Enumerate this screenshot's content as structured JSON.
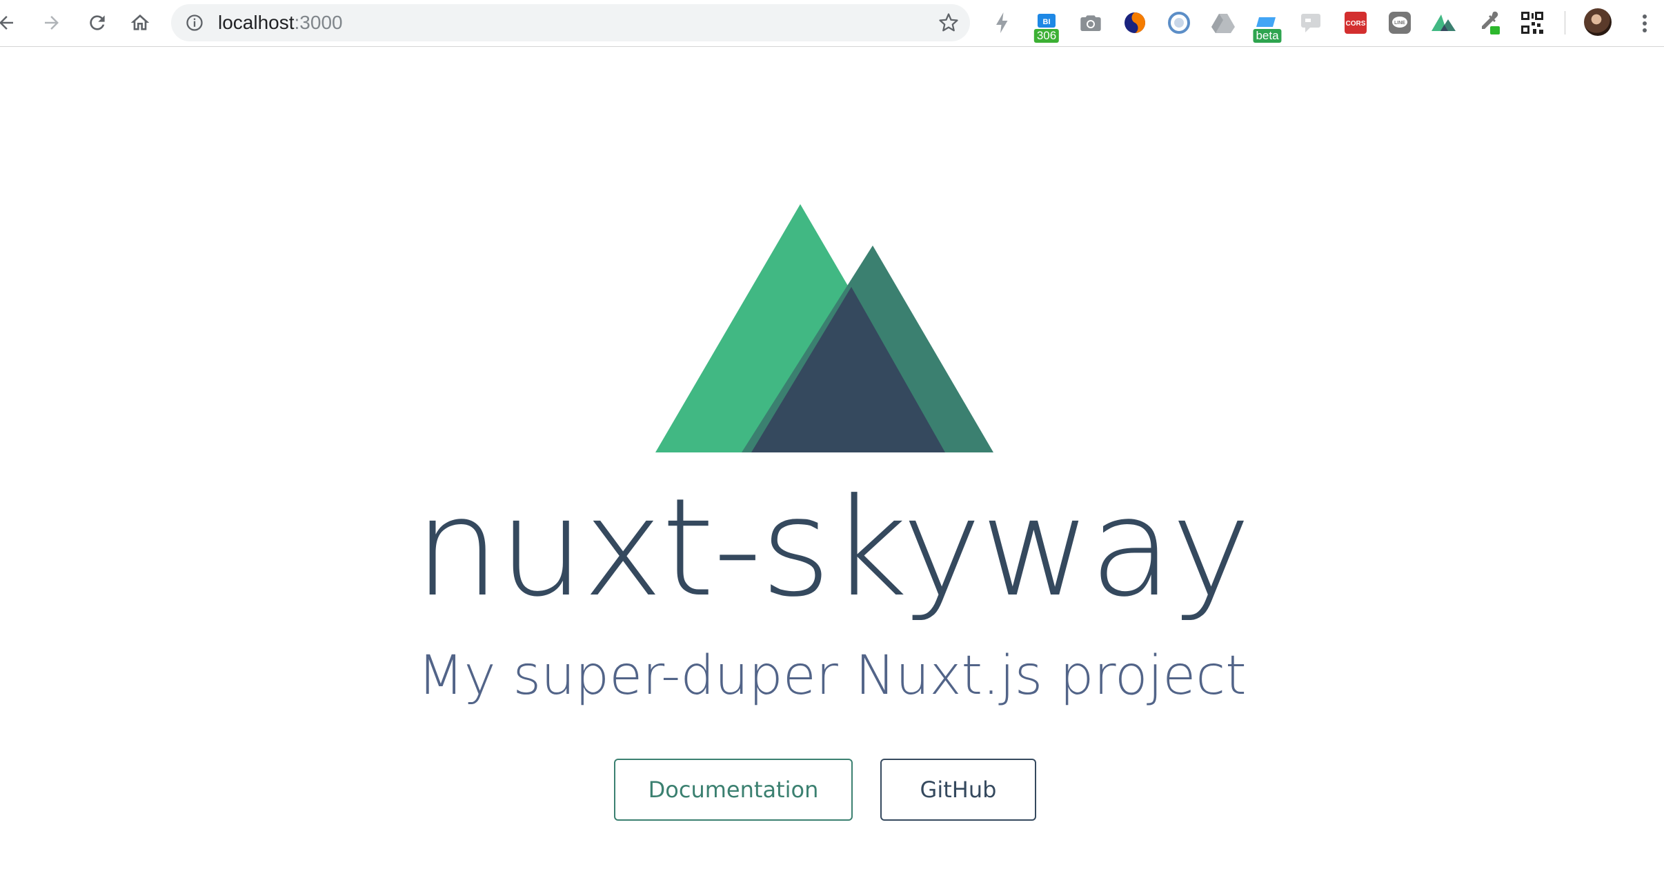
{
  "browser": {
    "url_host": "localhost",
    "url_port": ":3000",
    "extensions": [
      {
        "name": "bolt-icon"
      },
      {
        "name": "bi-extension-icon",
        "label": "BI",
        "badge": "306",
        "badge_color": "#3cb034"
      },
      {
        "name": "camera-icon"
      },
      {
        "name": "swirl-extension-icon"
      },
      {
        "name": "circle-extension-icon"
      },
      {
        "name": "google-drive-icon"
      },
      {
        "name": "beta-extension-icon",
        "badge": "beta",
        "badge_color": "#2ea44f"
      },
      {
        "name": "chat-bubble-icon"
      },
      {
        "name": "cors-extension-icon",
        "label": "CORS",
        "color": "#d32f2f"
      },
      {
        "name": "line-extension-icon",
        "label": "LINE"
      },
      {
        "name": "nuxt-extension-icon"
      },
      {
        "name": "eyedropper-icon"
      },
      {
        "name": "qr-code-icon"
      }
    ]
  },
  "hero": {
    "title": "nuxt-skyway",
    "subtitle": "My super-duper Nuxt.js project"
  },
  "links": {
    "documentation_label": "Documentation",
    "github_label": "GitHub"
  },
  "colors": {
    "nuxt_green": "#41b883",
    "nuxt_dark_green": "#3b8070",
    "nuxt_navy": "#35495e"
  }
}
